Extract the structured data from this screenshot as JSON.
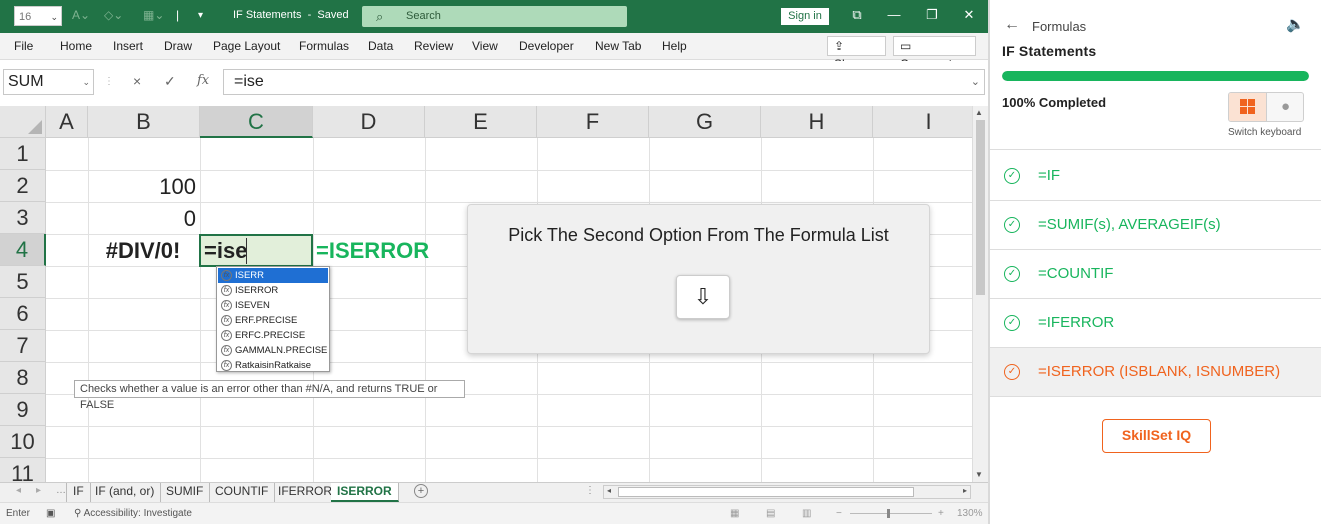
{
  "titlebar": {
    "font_size": "16",
    "doc_title": "IF Statements",
    "doc_status": "Saved",
    "search_placeholder": "Search",
    "signin_label": "Sign in"
  },
  "menu": [
    "File",
    "Home",
    "Insert",
    "Draw",
    "Page Layout",
    "Formulas",
    "Data",
    "Review",
    "View",
    "Developer",
    "New Tab",
    "Help"
  ],
  "menu_right": {
    "share": "Share",
    "comments": "Comments"
  },
  "formula_bar": {
    "name_box": "SUM",
    "cancel": "×",
    "enter": "✓",
    "fx": "fx",
    "value": "=ise"
  },
  "grid": {
    "columns": [
      "A",
      "B",
      "C",
      "D",
      "E",
      "F",
      "G",
      "H",
      "I"
    ],
    "rows": [
      "1",
      "2",
      "3",
      "4",
      "5",
      "6",
      "7",
      "8",
      "9",
      "10",
      "11"
    ],
    "selected_column": "C",
    "selected_row": "4",
    "cells": {
      "B2": "100",
      "B3": "0",
      "B4": "#DIV/0!",
      "C4": "=ise",
      "D4": "=ISERROR"
    }
  },
  "autocomplete": {
    "items": [
      "ISERR",
      "ISERROR",
      "ISEVEN",
      "ERF.PRECISE",
      "ERFC.PRECISE",
      "GAMMALN.PRECISE",
      "RatkaisinRatkaise"
    ],
    "highlighted_index": 0,
    "tooltip": "Checks whether a value is an error other than #N/A, and returns TRUE or FALSE"
  },
  "hint": {
    "message": "Pick The Second Option From The Formula List",
    "button_icon": "arrow-down-icon"
  },
  "sheet_tabs": [
    "IF",
    "IF (and, or)",
    "SUMIF",
    "COUNTIF",
    "IFERROR",
    "ISERROR"
  ],
  "active_sheet": "ISERROR",
  "statusbar": {
    "mode": "Enter",
    "accessibility": "Accessibility: Investigate",
    "zoom": "130%"
  },
  "panel": {
    "crumb": "Formulas",
    "title": "IF Statements",
    "progress": 1.0,
    "progress_label": "100% Completed",
    "switch_keyboard": "Switch keyboard",
    "lessons": [
      "=IF",
      "=SUMIF(s), AVERAGEIF(s)",
      "=COUNTIF",
      "=IFERROR",
      "=ISERROR (ISBLANK, ISNUMBER)"
    ],
    "current_lesson": 4,
    "brand_button": "SkillSet IQ"
  },
  "colors": {
    "excel_green": "#217346",
    "accent_green": "#18b55d",
    "accent_orange": "#f0631e"
  }
}
